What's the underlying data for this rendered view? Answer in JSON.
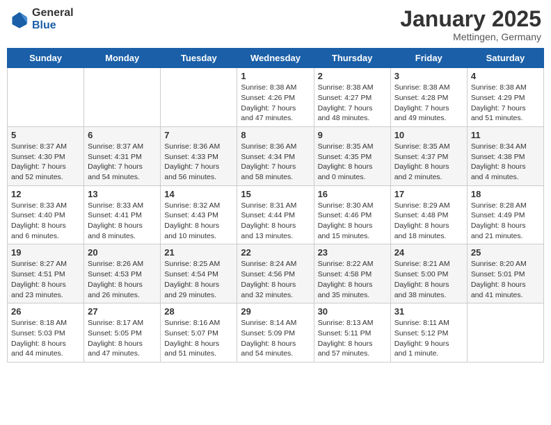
{
  "logo": {
    "line1": "General",
    "line2": "Blue"
  },
  "title": "January 2025",
  "location": "Mettingen, Germany",
  "weekdays": [
    "Sunday",
    "Monday",
    "Tuesday",
    "Wednesday",
    "Thursday",
    "Friday",
    "Saturday"
  ],
  "weeks": [
    [
      null,
      null,
      null,
      {
        "day": "1",
        "sunrise": "8:38 AM",
        "sunset": "4:26 PM",
        "daylight": "7 hours and 47 minutes."
      },
      {
        "day": "2",
        "sunrise": "8:38 AM",
        "sunset": "4:27 PM",
        "daylight": "7 hours and 48 minutes."
      },
      {
        "day": "3",
        "sunrise": "8:38 AM",
        "sunset": "4:28 PM",
        "daylight": "7 hours and 49 minutes."
      },
      {
        "day": "4",
        "sunrise": "8:38 AM",
        "sunset": "4:29 PM",
        "daylight": "7 hours and 51 minutes."
      }
    ],
    [
      {
        "day": "5",
        "sunrise": "8:37 AM",
        "sunset": "4:30 PM",
        "daylight": "7 hours and 52 minutes."
      },
      {
        "day": "6",
        "sunrise": "8:37 AM",
        "sunset": "4:31 PM",
        "daylight": "7 hours and 54 minutes."
      },
      {
        "day": "7",
        "sunrise": "8:36 AM",
        "sunset": "4:33 PM",
        "daylight": "7 hours and 56 minutes."
      },
      {
        "day": "8",
        "sunrise": "8:36 AM",
        "sunset": "4:34 PM",
        "daylight": "7 hours and 58 minutes."
      },
      {
        "day": "9",
        "sunrise": "8:35 AM",
        "sunset": "4:35 PM",
        "daylight": "8 hours and 0 minutes."
      },
      {
        "day": "10",
        "sunrise": "8:35 AM",
        "sunset": "4:37 PM",
        "daylight": "8 hours and 2 minutes."
      },
      {
        "day": "11",
        "sunrise": "8:34 AM",
        "sunset": "4:38 PM",
        "daylight": "8 hours and 4 minutes."
      }
    ],
    [
      {
        "day": "12",
        "sunrise": "8:33 AM",
        "sunset": "4:40 PM",
        "daylight": "8 hours and 6 minutes."
      },
      {
        "day": "13",
        "sunrise": "8:33 AM",
        "sunset": "4:41 PM",
        "daylight": "8 hours and 8 minutes."
      },
      {
        "day": "14",
        "sunrise": "8:32 AM",
        "sunset": "4:43 PM",
        "daylight": "8 hours and 10 minutes."
      },
      {
        "day": "15",
        "sunrise": "8:31 AM",
        "sunset": "4:44 PM",
        "daylight": "8 hours and 13 minutes."
      },
      {
        "day": "16",
        "sunrise": "8:30 AM",
        "sunset": "4:46 PM",
        "daylight": "8 hours and 15 minutes."
      },
      {
        "day": "17",
        "sunrise": "8:29 AM",
        "sunset": "4:48 PM",
        "daylight": "8 hours and 18 minutes."
      },
      {
        "day": "18",
        "sunrise": "8:28 AM",
        "sunset": "4:49 PM",
        "daylight": "8 hours and 21 minutes."
      }
    ],
    [
      {
        "day": "19",
        "sunrise": "8:27 AM",
        "sunset": "4:51 PM",
        "daylight": "8 hours and 23 minutes."
      },
      {
        "day": "20",
        "sunrise": "8:26 AM",
        "sunset": "4:53 PM",
        "daylight": "8 hours and 26 minutes."
      },
      {
        "day": "21",
        "sunrise": "8:25 AM",
        "sunset": "4:54 PM",
        "daylight": "8 hours and 29 minutes."
      },
      {
        "day": "22",
        "sunrise": "8:24 AM",
        "sunset": "4:56 PM",
        "daylight": "8 hours and 32 minutes."
      },
      {
        "day": "23",
        "sunrise": "8:22 AM",
        "sunset": "4:58 PM",
        "daylight": "8 hours and 35 minutes."
      },
      {
        "day": "24",
        "sunrise": "8:21 AM",
        "sunset": "5:00 PM",
        "daylight": "8 hours and 38 minutes."
      },
      {
        "day": "25",
        "sunrise": "8:20 AM",
        "sunset": "5:01 PM",
        "daylight": "8 hours and 41 minutes."
      }
    ],
    [
      {
        "day": "26",
        "sunrise": "8:18 AM",
        "sunset": "5:03 PM",
        "daylight": "8 hours and 44 minutes."
      },
      {
        "day": "27",
        "sunrise": "8:17 AM",
        "sunset": "5:05 PM",
        "daylight": "8 hours and 47 minutes."
      },
      {
        "day": "28",
        "sunrise": "8:16 AM",
        "sunset": "5:07 PM",
        "daylight": "8 hours and 51 minutes."
      },
      {
        "day": "29",
        "sunrise": "8:14 AM",
        "sunset": "5:09 PM",
        "daylight": "8 hours and 54 minutes."
      },
      {
        "day": "30",
        "sunrise": "8:13 AM",
        "sunset": "5:11 PM",
        "daylight": "8 hours and 57 minutes."
      },
      {
        "day": "31",
        "sunrise": "8:11 AM",
        "sunset": "5:12 PM",
        "daylight": "9 hours and 1 minute."
      },
      null
    ]
  ],
  "labels": {
    "sunrise": "Sunrise:",
    "sunset": "Sunset:",
    "daylight": "Daylight:"
  }
}
